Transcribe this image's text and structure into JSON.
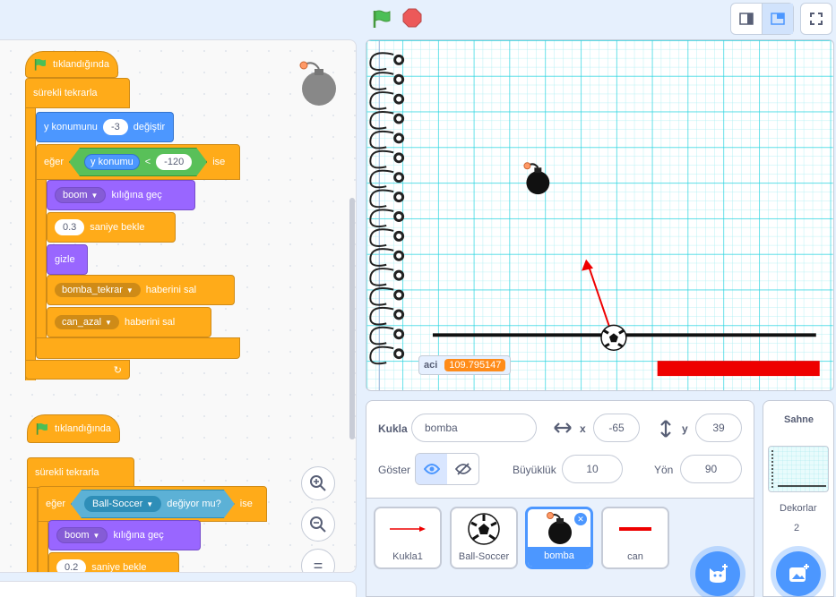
{
  "code": {
    "script1": {
      "hat": "tıklandığında",
      "forever": "sürekli tekrarla",
      "change_y_label": "y konumunu",
      "change_y_value": "-3",
      "change_y_suffix": "değiştir",
      "if_label": "eğer",
      "if_suffix": "ise",
      "reporter": "y konumu",
      "compare_op": "<",
      "compare_value": "-120",
      "switch_costume_value": "boom",
      "switch_costume_suffix": "kılığına geç",
      "wait_value": "0.3",
      "wait_suffix": "saniye bekle",
      "hide": "gizle",
      "broadcast1_value": "bomba_tekrar",
      "broadcast_suffix": "haberini sal",
      "broadcast2_value": "can_azal",
      "loop_arrow": "↻"
    },
    "script2": {
      "hat": "tıklandığında",
      "forever": "sürekli tekrarla",
      "if_label": "eğer",
      "touching_value": "Ball-Soccer",
      "touching_suffix": "değiyor mu?",
      "if_suffix": "ise",
      "switch_costume_value": "boom",
      "switch_costume_suffix": "kılığına geç",
      "wait_value": "0.2",
      "wait_suffix": "saniye bekle"
    },
    "zoom_in": "+",
    "zoom_out": "−",
    "zoom_reset": "="
  },
  "stage": {
    "variable_name": "aci",
    "variable_value": "109.795147"
  },
  "sprite_info": {
    "sprite_label": "Kukla",
    "sprite_name": "bomba",
    "x_label": "x",
    "x_value": "-65",
    "y_label": "y",
    "y_value": "39",
    "show_label": "Göster",
    "size_label": "Büyüklük",
    "size_value": "10",
    "direction_label": "Yön",
    "direction_value": "90"
  },
  "sprites": [
    {
      "name": "Kukla1"
    },
    {
      "name": "Ball-Soccer"
    },
    {
      "name": "bomba",
      "selected": true
    },
    {
      "name": "can"
    }
  ],
  "stage_panel": {
    "title": "Sahne",
    "backdrops_label": "Dekorlar",
    "backdrops_count": "2"
  },
  "colors": {
    "accent": "#4c97ff",
    "events": "#ffab19",
    "motion": "#4c97ff",
    "looks": "#9966ff",
    "operators": "#59c059",
    "sensing": "#5cb1d6"
  }
}
